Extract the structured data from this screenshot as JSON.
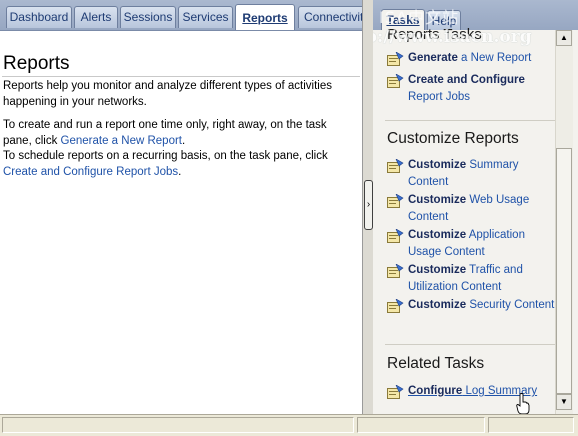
{
  "tabs": [
    {
      "label": "Dashboard"
    },
    {
      "label": "Alerts"
    },
    {
      "label": "Sessions"
    },
    {
      "label": "Services"
    },
    {
      "label": "Reports"
    },
    {
      "label": "Connectivity"
    }
  ],
  "main": {
    "title": "Reports",
    "description": "Reports help you monitor and analyze different types of activities happening in your networks.",
    "p2_before": "To create and run a report one time only, right away, on the task pane, click ",
    "p2_link": "Generate a New Report",
    "p2_after": ".",
    "p3_before": "To schedule reports on a recurring basis, on the task pane, click ",
    "p3_link": "Create and Configure Report Jobs",
    "p3_after": "."
  },
  "splitter": {
    "arrow": "›"
  },
  "taskpane": {
    "tabs": {
      "tasks": "Tasks",
      "help": "Help"
    },
    "watermark_top": "ISA中文站",
    "watermark_url": "http://www.isacn.org",
    "partial_header": "Reports Tasks",
    "report_tasks": [
      {
        "bold": "Generate",
        "rest": " a New Report"
      },
      {
        "bold": "Create and Configure",
        "rest": " Report Jobs"
      }
    ],
    "customize_title": "Customize Reports",
    "customize_tasks": [
      {
        "bold": "Customize",
        "rest": " Summary Content"
      },
      {
        "bold": "Customize",
        "rest": " Web Usage Content"
      },
      {
        "bold": "Customize",
        "rest": " Application Usage Content"
      },
      {
        "bold": "Customize",
        "rest": " Traffic and Utilization Content"
      },
      {
        "bold": "Customize",
        "rest": " Security Content"
      }
    ],
    "related_title": "Related Tasks",
    "related_tasks": [
      {
        "bold": "Configure",
        "rest": " Log Summary"
      }
    ]
  },
  "scrollbar": {
    "up": "▲",
    "down": "▼"
  },
  "colors": {
    "link": "#1f52a8",
    "tabbar": "#a6b5cd",
    "taskpane_bg": "#f3f2ee"
  }
}
